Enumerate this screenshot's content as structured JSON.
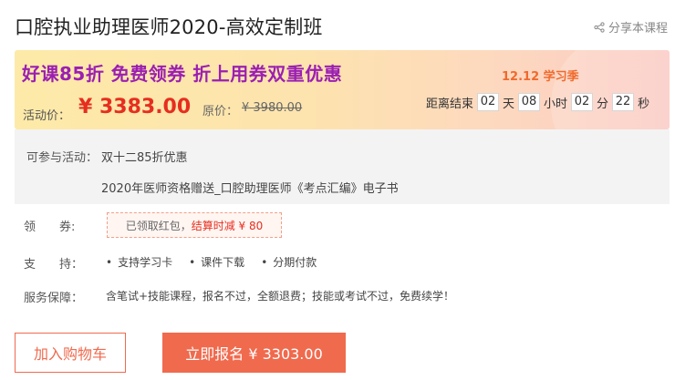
{
  "course": {
    "title": "口腔执业助理医师2020-高效定制班",
    "share_label": "分享本课程"
  },
  "promo": {
    "headline": "好课85折  免费领券 折上用券双重优惠",
    "season": "12.12 学习季",
    "price_label": "活动价：",
    "price": "¥ 3383.00",
    "original_label": "原价：",
    "original_price": "¥ 3980.00",
    "countdown": {
      "label": "距离结束",
      "days": "02",
      "days_unit": "天",
      "hours": "08",
      "hours_unit": "小时",
      "minutes": "02",
      "minutes_unit": "分",
      "seconds": "22",
      "seconds_unit": "秒"
    }
  },
  "activity": {
    "label": "可参与活动：",
    "items": [
      "双十二85折优惠",
      "2020年医师资格赠送_口腔助理医师《考点汇编》电子书"
    ]
  },
  "coupon": {
    "label": "领　　券:",
    "text": "已领取红包，",
    "highlight": "结算时减 ¥ 80"
  },
  "support": {
    "label": "支　　持：",
    "items": [
      "支持学习卡",
      "课件下载",
      "分期付款"
    ]
  },
  "guarantee": {
    "label": "服务保障：",
    "text": "含笔试+技能课程，报名不过，全额退费；技能或考试不过，免费续学！"
  },
  "actions": {
    "cart_label": "加入购物车",
    "buy_label": "立即报名 ¥ 3303.00"
  },
  "colors": {
    "accent": "#f06a4e",
    "price_red": "#e62e20",
    "headline_purple": "#9b1fb2"
  }
}
